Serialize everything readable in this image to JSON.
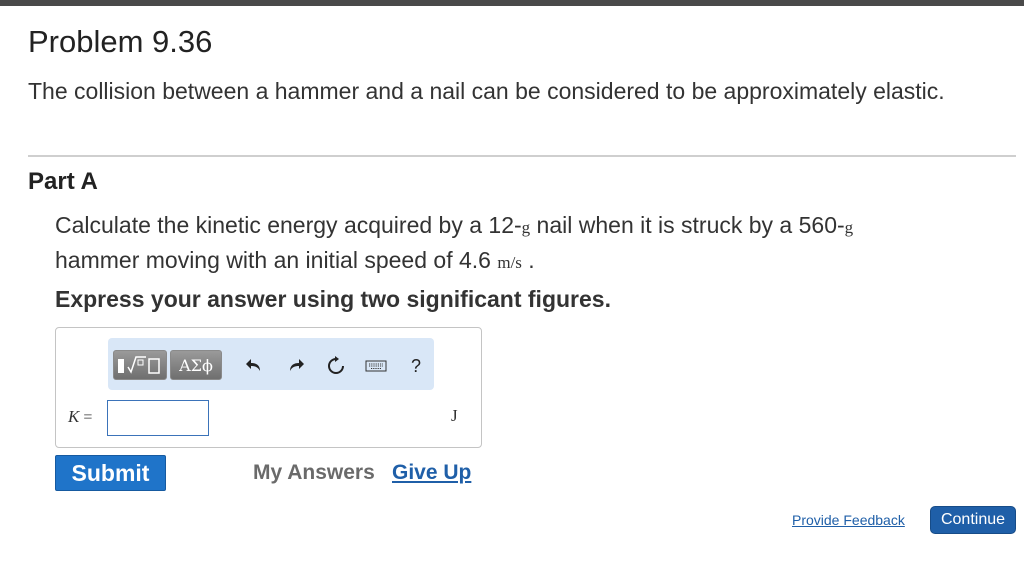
{
  "problem": {
    "title": "Problem 9.36",
    "intro": "The collision between a hammer and a nail can be considered to be approximately elastic."
  },
  "part": {
    "title": "Part A",
    "question": {
      "text1": "Calculate the kinetic energy acquired by a 12-",
      "unit1": "g",
      "text2": " nail when it is struck by a 560-",
      "unit2": "g",
      "text3": " hammer moving with an initial speed of 4.6 ",
      "unit3": "m/s",
      "text4": " ."
    },
    "instruction": "Express your answer using two significant figures."
  },
  "answer": {
    "toolbar": {
      "templates_icon": "templates-icon",
      "symbols_label": "ΑΣϕ",
      "undo_icon": "undo-icon",
      "redo_icon": "redo-icon",
      "reset_icon": "reset-icon",
      "keyboard_icon": "keyboard-icon",
      "help_label": "?"
    },
    "variable": "K",
    "equals": "=",
    "value": "",
    "unit": "J"
  },
  "actions": {
    "submit": "Submit",
    "my_answers": "My Answers",
    "give_up": "Give Up"
  },
  "footer": {
    "feedback": "Provide Feedback",
    "continue": "Continue"
  },
  "colors": {
    "primary": "#1f74c9",
    "link": "#1f5fa8",
    "toolbar_bg": "#d9e7f7"
  }
}
